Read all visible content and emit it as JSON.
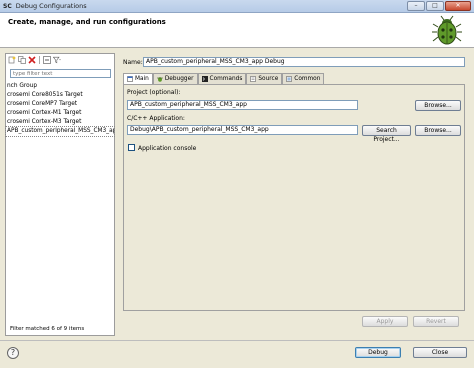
{
  "window": {
    "app_logo": "SC",
    "title": "Debug Configurations",
    "controls": [
      "–",
      "□",
      "✕"
    ]
  },
  "header": {
    "title": "Create, manage, and run configurations",
    "icon": "bug-icon"
  },
  "left": {
    "toolbar_icons": [
      "new-config-icon",
      "duplicate-icon",
      "delete-icon",
      "collapse-all-icon",
      "filter-icon"
    ],
    "filter_placeholder": "type filter text",
    "tree_items": [
      "nch Group",
      "crosemi Core8051s Target",
      "crosemi CoreMP7 Target",
      "crosemi Cortex-M1 Target",
      "crosemi Cortex-M3 Target",
      "APB_custom_peripheral_MSS_CM3_ap"
    ],
    "filter_status": "Filter matched 6 of 9 items"
  },
  "right": {
    "name_label": "Name:",
    "name_value": "APB_custom_peripheral_MSS_CM3_app Debug",
    "tabs": [
      {
        "label": "Main",
        "icon": "main-tab-icon",
        "active": true
      },
      {
        "label": "Debugger",
        "icon": "debugger-tab-icon",
        "active": false
      },
      {
        "label": "Commands",
        "icon": "commands-tab-icon",
        "active": false
      },
      {
        "label": "Source",
        "icon": "source-tab-icon",
        "active": false
      },
      {
        "label": "Common",
        "icon": "common-tab-icon",
        "active": false
      }
    ],
    "project_label": "Project (optional):",
    "project_value": "APB_custom_peripheral_MSS_CM3_app",
    "browse_label": "Browse...",
    "app_label": "C/C++ Application:",
    "app_value": "Debug\\APB_custom_peripheral_MSS_CM3_app",
    "search_project_label": "Search Project...",
    "browse2_label": "Browse...",
    "console_label": "Application console",
    "apply_label": "Apply",
    "revert_label": "Revert"
  },
  "footer": {
    "help": "?",
    "debug_label": "Debug",
    "close_label": "Close"
  }
}
